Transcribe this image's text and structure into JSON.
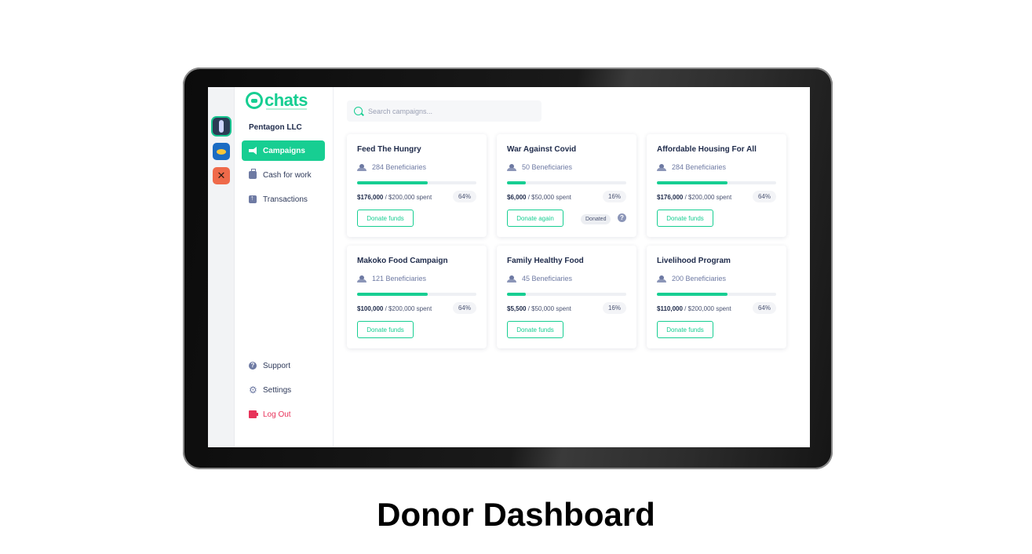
{
  "caption": "Donor Dashboard",
  "logo": {
    "text": "chats"
  },
  "org_name": "Pentagon LLC",
  "nav": {
    "campaigns": "Campaigns",
    "cash_for_work": "Cash for work",
    "transactions": "Transactions",
    "support": "Support",
    "settings": "Settings",
    "logout": "Log Out"
  },
  "search": {
    "placeholder": "Search campaigns..."
  },
  "colors": {
    "accent": "#17ce92",
    "text_dark": "#1e2a4a",
    "logout": "#e8335a"
  },
  "campaigns": [
    {
      "title": "Feed The Hungry",
      "beneficiaries": "284 Beneficiaries",
      "spent": "$176,000",
      "total": "/ $200,000 spent",
      "percent": "64%",
      "progress": 0.59,
      "button": "Donate funds"
    },
    {
      "title": "War Against Covid",
      "beneficiaries": "50 Beneficiaries",
      "spent": "$6,000",
      "total": "/ $50,000 spent",
      "percent": "16%",
      "progress": 0.16,
      "button": "Donate again",
      "badge": "Donated"
    },
    {
      "title": "Affordable Housing For All",
      "beneficiaries": "284 Beneficiaries",
      "spent": "$176,000",
      "total": "/ $200,000 spent",
      "percent": "64%",
      "progress": 0.59,
      "button": "Donate funds"
    },
    {
      "title": "Makoko Food Campaign",
      "beneficiaries": "121 Beneficiaries",
      "spent": "$100,000",
      "total": "/ $200,000 spent",
      "percent": "64%",
      "progress": 0.59,
      "button": "Donate funds"
    },
    {
      "title": "Family Healthy Food",
      "beneficiaries": "45 Beneficiaries",
      "spent": "$5,500",
      "total": "/ $50,000 spent",
      "percent": "16%",
      "progress": 0.16,
      "button": "Donate funds"
    },
    {
      "title": "Livelihood Program",
      "beneficiaries": "200 Beneficiaries",
      "spent": "$110,000",
      "total": "/ $200,000 spent",
      "percent": "64%",
      "progress": 0.59,
      "button": "Donate funds"
    }
  ]
}
